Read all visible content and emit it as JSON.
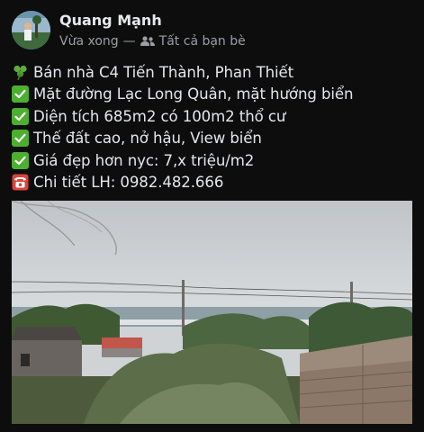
{
  "post": {
    "author": "Quang Mạnh",
    "time": "Vừa xong",
    "separator": "—",
    "audience": "Tất cả bạn bè",
    "audience_icon": "friends-icon",
    "lines": [
      {
        "icon": "shamrock-icon",
        "text": "Bán nhà C4 Tiến Thành, Phan Thiết"
      },
      {
        "icon": "check-icon",
        "text": "Mặt đường Lạc Long Quân, mặt hướng biển"
      },
      {
        "icon": "check-icon",
        "text": "Diện tích 685m2 có 100m2 thổ cư"
      },
      {
        "icon": "check-icon",
        "text": "Thế đất cao, nở hậu, View biển"
      },
      {
        "icon": "check-icon",
        "text": "Giá đẹp hơn nyc: 7,x triệu/m2"
      },
      {
        "icon": "telephone-icon",
        "text": "Chi tiết LH: 0982.482.666"
      }
    ]
  },
  "colors": {
    "background": "#0d0d0d",
    "text": "#e4e6eb",
    "meta": "#9a9ea5",
    "check": "#4caf2f",
    "phone": "#d9443a"
  }
}
